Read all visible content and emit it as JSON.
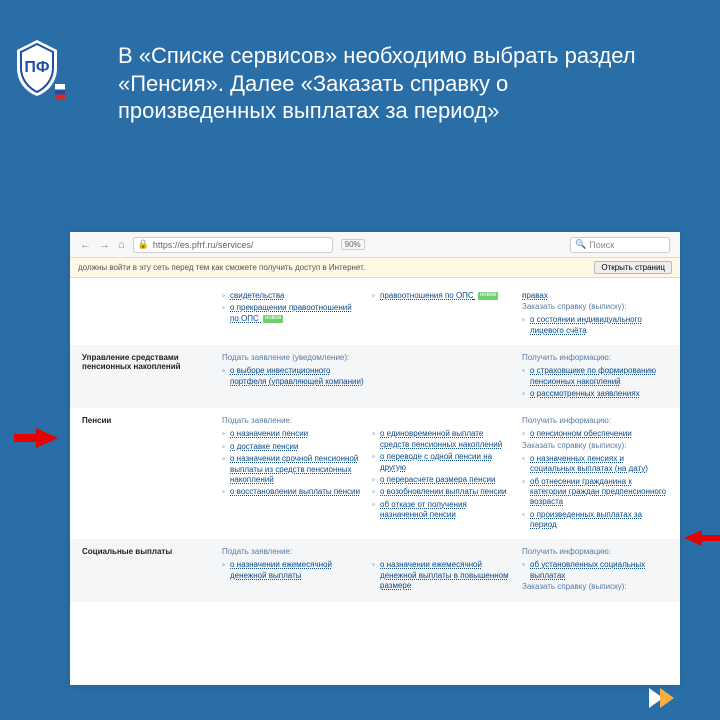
{
  "headline": "В «Списке сервисов» необходимо выбрать раздел «Пенсия». Далее «Заказать справку о произведенных выплатах за период»",
  "chrome": {
    "url": "https://es.pfrf.ru/services/",
    "zoom": "90%",
    "search_placeholder": "Поиск"
  },
  "infobar": {
    "message": "должны войти в эту сеть перед тем как сможете получить доступ в Интернет.",
    "button": "Открыть страниц"
  },
  "row0": {
    "mid_link1": "свидетельства",
    "mid_link2_a": "о прекращении правоотношений",
    "mid_link2_b": "по ОПС",
    "mid2_text": "правоотношения по ОПС",
    "right_head0": "правах",
    "right_head": "Заказать справку (выписку):",
    "right_link1": "о состоянии индивидуального лицевого счёта"
  },
  "row1": {
    "title": "Управление средствами пенсионных накоплений",
    "mid_head": "Подать заявление (уведомление):",
    "mid_link1": "о выборе инвестиционного портфеля (управляющей компании)",
    "right_head": "Получить информацию:",
    "right_link1": "о страховщике по формированию пенсионных накоплений",
    "right_link2": "о рассмотренных заявлениях"
  },
  "row2": {
    "title": "Пенсии",
    "mid_head": "Подать заявление:",
    "mid_link1": "о назначении пенсии",
    "mid_link2": "о доставке пенсии",
    "mid_link3": "о назначении срочной пенсионной выплаты из средств пенсионных накоплений",
    "mid_link4": "о восстановлении выплаты пенсии",
    "mid2_link1": "о единовременной выплате средств пенсионных накоплений",
    "mid2_link2": "о переводе с одной пенсии на другую",
    "mid2_link3": "о перерасчете размера пенсии",
    "mid2_link4": "о возобновлении выплаты пенсии",
    "mid2_link5": "об отказе от получения назначенной пенсии",
    "right_head1": "Получить информацию:",
    "right_link1": "о пенсионном обеспечении",
    "right_head2": "Заказать справку (выписку):",
    "right_link2": "о назначенных пенсиях и социальных выплатах (на дату)",
    "right_link3": "об отнесении гражданина к категории граждан предпенсионного возраста",
    "right_link4": "о произведенных выплатах за период"
  },
  "row3": {
    "title": "Социальные выплаты",
    "mid_head": "Подать заявление:",
    "mid_link1": "о назначении ежемесячной денежной выплаты",
    "mid2_link1": "о назначении ежемесячной денежной выплаты в повышенном размере",
    "right_head1": "Получить информацию:",
    "right_link1": "об установленных социальных выплатах",
    "right_head2": "Заказать справку (выписку):"
  },
  "badge_new": "новое"
}
